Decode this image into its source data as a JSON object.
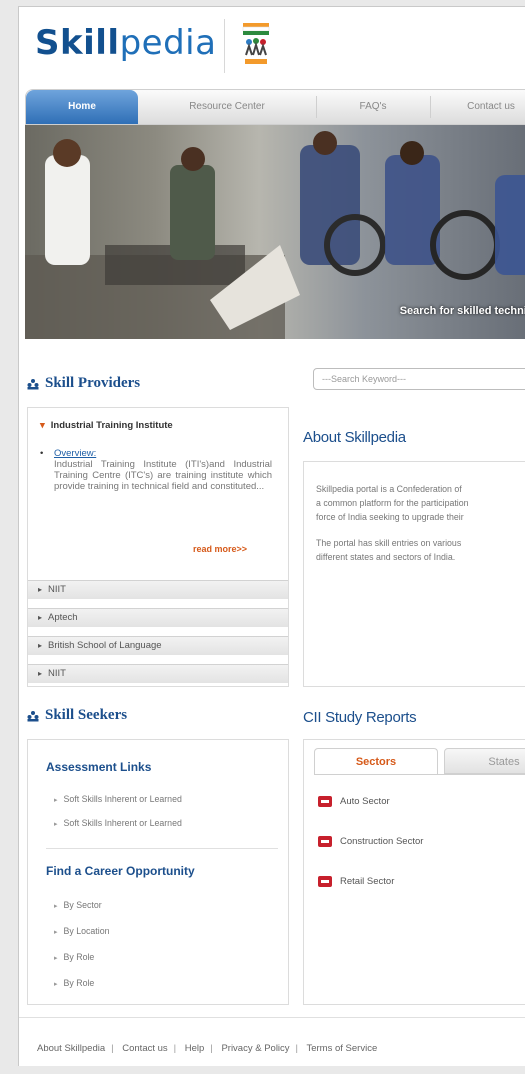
{
  "brand": {
    "logo_bold": "Skill",
    "logo_rest": "pedia"
  },
  "nav": {
    "items": [
      {
        "label": "Home",
        "active": true
      },
      {
        "label": "Resource Center"
      },
      {
        "label": "FAQ's"
      },
      {
        "label": "Contact us"
      }
    ]
  },
  "banner": {
    "caption": "Search for skilled technicians"
  },
  "providers": {
    "title": "Skill Providers",
    "open_item": {
      "label": "Industrial Training Institute",
      "overview_label": "Overview:",
      "overview_text": "Industrial Training Institute (ITI's)and Industrial Training Centre (ITC's) are training institute which provide training in technical field and constituted...",
      "read_more": "read more>>"
    },
    "items": [
      "NIIT",
      "Aptech",
      "British School of Language",
      "NIIT"
    ]
  },
  "search": {
    "placeholder": "---Search Keyword---"
  },
  "about": {
    "title": "About Skillpedia",
    "para1": "Skillpedia portal is a Confederation of\na common platform for the participation\nforce of India seeking to upgrade their",
    "para2": "The portal has skill entries on various\ndifferent states and sectors of India."
  },
  "seekers": {
    "title": "Skill Seekers",
    "assessment_title": "Assessment Links",
    "assessment_links": [
      "Soft Skills Inherent or Learned",
      "Soft Skills Inherent or Learned"
    ],
    "career_title": "Find a Career Opportunity",
    "career_links": [
      "By Sector",
      "By Location",
      "By Role",
      "By Role"
    ]
  },
  "reports": {
    "title": "CII Study Reports",
    "tabs": [
      {
        "label": "Sectors",
        "active": true
      },
      {
        "label": "States"
      }
    ],
    "items": [
      "Auto Sector",
      "Construction Sector",
      "Retail Sector"
    ]
  },
  "footer": {
    "links": [
      "About Skillpedia",
      "Contact us",
      "Help",
      "Privacy & Policy",
      "Terms of Service"
    ]
  },
  "colors": {
    "brand_blue": "#1c4f8c",
    "accent_orange": "#d65a1a",
    "nav_active": "#2f6fb6"
  }
}
